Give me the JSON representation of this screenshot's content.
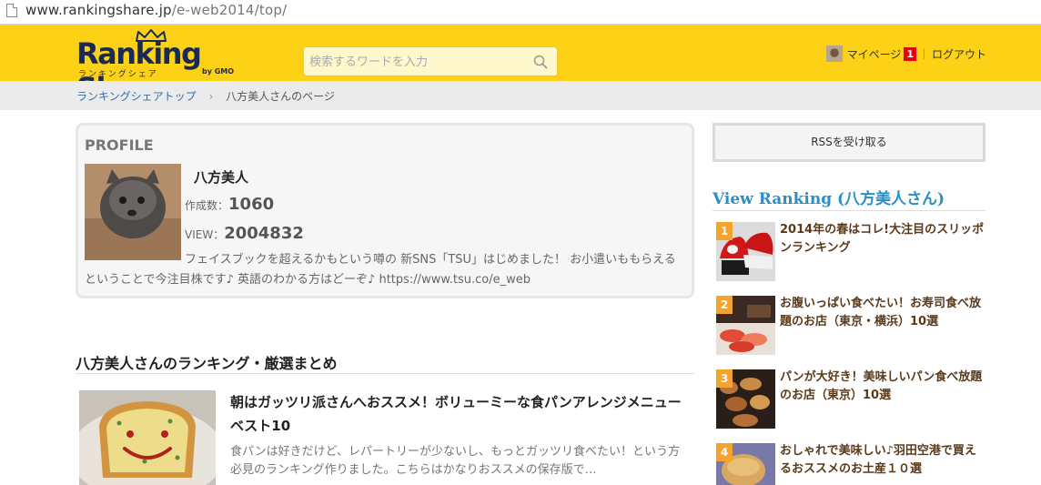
{
  "browser": {
    "url_host": "www.rankingshare.jp",
    "url_path": "/e-web2014/top/"
  },
  "header": {
    "logo_text_1": "Ranking",
    "logo_text_2": "Share",
    "logo_sub": "ランキングシェア",
    "logo_by": "by GMO",
    "search_placeholder": "検索するワードを入力",
    "mypage_label": "マイページ",
    "notification_count": "1",
    "logout_label": "ログアウト"
  },
  "breadcrumb": {
    "home": "ランキングシェアトップ",
    "arrow": "›",
    "current": "八方美人さんのページ"
  },
  "profile": {
    "title": "PROFILE",
    "name": "八方美人",
    "created_label": "作成数：",
    "created_value": "1060",
    "view_label": "VIEW：",
    "view_value": "2004832",
    "description": "フェイスブックを超えるかもという噂の 新SNS「TSU」はじめました！ お小遣いももらえるということで今注目株です♪ 英語のわかる方はどーぞ♪ https://www.tsu.co/e_web"
  },
  "sidebar": {
    "rss_label": "RSSを受け取る",
    "view_ranking_title": "View Ranking (八方美人さん)",
    "items": [
      {
        "rank": "1",
        "title": "2014年の春はコレ!大注目のスリッポンランキング"
      },
      {
        "rank": "2",
        "title": "お腹いっぱい食べたい！お寿司食べ放題のお店（東京・横浜）10選"
      },
      {
        "rank": "3",
        "title": "パンが大好き！美味しいパン食べ放題のお店（東京）10選"
      },
      {
        "rank": "4",
        "title": "おしゃれで美味しい♪羽田空港で買えるおススメのお土産１０選"
      }
    ]
  },
  "rankings": {
    "section_title": "八方美人さんのランキング・厳選まとめ",
    "entries": [
      {
        "title": "朝はガッツリ派さんへおススメ！ボリューミーな食パンアレンジメニューベスト10",
        "description": "食パンは好きだけど、レパートリーが少ないし、もっとガッツリ食べたい！という方必見のランキング作りました。こちらはかなりおススメの保存版で…"
      }
    ]
  },
  "colors": {
    "header_bg": "#fcd116",
    "accent_blue": "#2a8fc6",
    "rank_badge": "#f5a32a"
  }
}
